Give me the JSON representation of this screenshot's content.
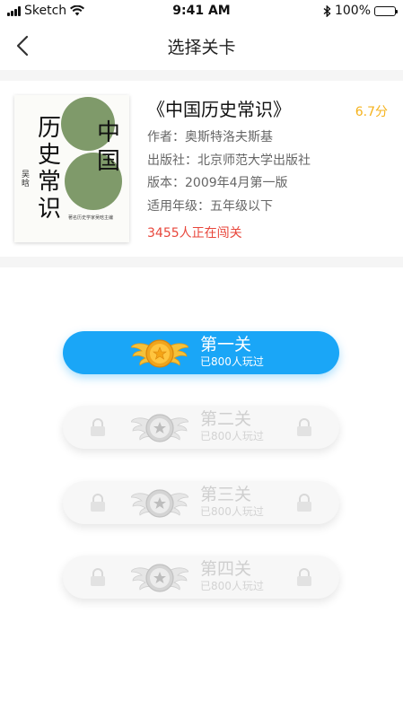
{
  "status_bar": {
    "carrier": "Sketch",
    "time": "9:41 AM",
    "battery": "100%"
  },
  "nav": {
    "title": "选择关卡",
    "back_icon": "chevron-left-icon"
  },
  "book": {
    "title": "《中国历史常识》",
    "score": "6.7分",
    "author": "作者：奥斯特洛夫斯基",
    "publisher": "出版社：北京师范大学出版社",
    "edition": "版本：2009年4月第一版",
    "grade": "适用年级：五年级以下",
    "challenge": "3455人正在闯关",
    "cover": {
      "title_vertical": "历史常识",
      "title_side": "中国",
      "author_name": "吴晗",
      "caption": "著名历史学家吴晗主编"
    }
  },
  "levels": [
    {
      "name": "第一关",
      "played": "已800人玩过",
      "state": "active"
    },
    {
      "name": "第二关",
      "played": "已800人玩过",
      "state": "locked"
    },
    {
      "name": "第三关",
      "played": "已800人玩过",
      "state": "locked"
    },
    {
      "name": "第四关",
      "played": "已800人玩过",
      "state": "locked"
    }
  ],
  "colors": {
    "accent": "#1aa6f7",
    "score": "#f5b21b",
    "challenge": "#e8463b",
    "cover_green": "#7f9a6a"
  }
}
